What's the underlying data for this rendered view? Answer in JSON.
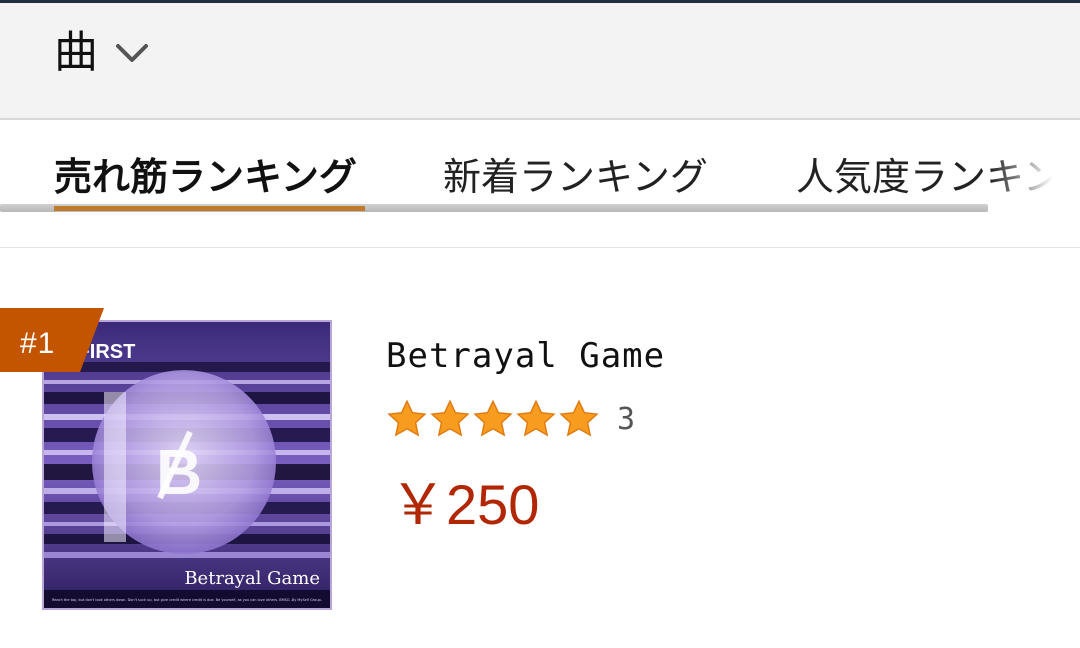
{
  "header": {
    "category_label": "曲",
    "dropdown_icon": "chevron-down-icon"
  },
  "tabs": [
    {
      "label": "売れ筋ランキング",
      "active": true
    },
    {
      "label": "新着ランキング",
      "active": false
    },
    {
      "label": "人気度ランキング",
      "active": false
    }
  ],
  "product": {
    "rank": "#1",
    "title": "Betrayal Game",
    "rating_stars": 5,
    "rating_count": "3",
    "price": "￥250",
    "cover": {
      "artist_text": "/FIRST",
      "title_text": "Betrayal Game",
      "logo_text": "B",
      "small_print": "Reach the top, but don't look others down. Don't suck up, but give credit where credit is due. Be yourself, as you can love others. BMSG  -By MySelf Group-"
    }
  },
  "colors": {
    "accent_underline": "#c07a2b",
    "rank_badge": "#c45500",
    "price": "#b12704",
    "star": "#f79c1f",
    "cover_purple": "#6b4fb0"
  }
}
